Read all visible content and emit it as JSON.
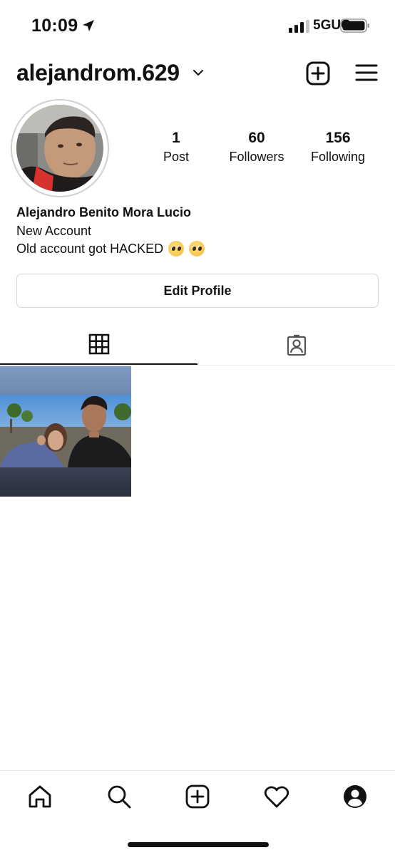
{
  "status_bar": {
    "time": "10:09",
    "network": "5GUC"
  },
  "header": {
    "username": "alejandrom.629",
    "icons": [
      "chevron-down-icon",
      "new-post-icon",
      "menu-icon"
    ]
  },
  "profile": {
    "stats": [
      {
        "value": "1",
        "label": "Post"
      },
      {
        "value": "60",
        "label": "Followers"
      },
      {
        "value": "156",
        "label": "Following"
      }
    ],
    "full_name": "Alejandro Benito Mora Lucio",
    "bio_line1": "New Account",
    "bio_line2": "Old account got HACKED",
    "bio_emoji": "pleading-face-emoji"
  },
  "edit_profile_label": "Edit Profile",
  "tabs": [
    "grid-icon",
    "tagged-icon"
  ],
  "bottom_nav": [
    "home-icon",
    "search-icon",
    "create-icon",
    "activity-heart-icon",
    "profile-icon"
  ],
  "colors": {
    "text": "#111111",
    "border": "#d6d6d6",
    "background": "#ffffff"
  }
}
